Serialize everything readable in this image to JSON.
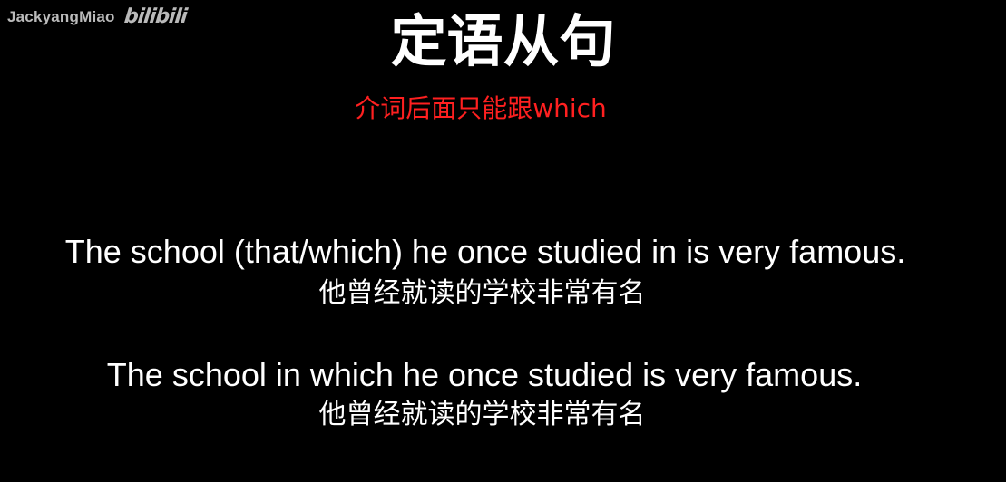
{
  "watermark": {
    "user": "JackyangMiao",
    "logo": "bilibili"
  },
  "title": "定语从句",
  "subtitle": "介词后面只能跟which",
  "examples": [
    {
      "english": "The school (that/which) he once studied in is very famous.",
      "chinese": "他曾经就读的学校非常有名"
    },
    {
      "english": "The school in which he once studied is very famous.",
      "chinese": "他曾经就读的学校非常有名"
    }
  ],
  "colors": {
    "background": "#000000",
    "text": "#ffffff",
    "highlight": "#ff2020"
  }
}
